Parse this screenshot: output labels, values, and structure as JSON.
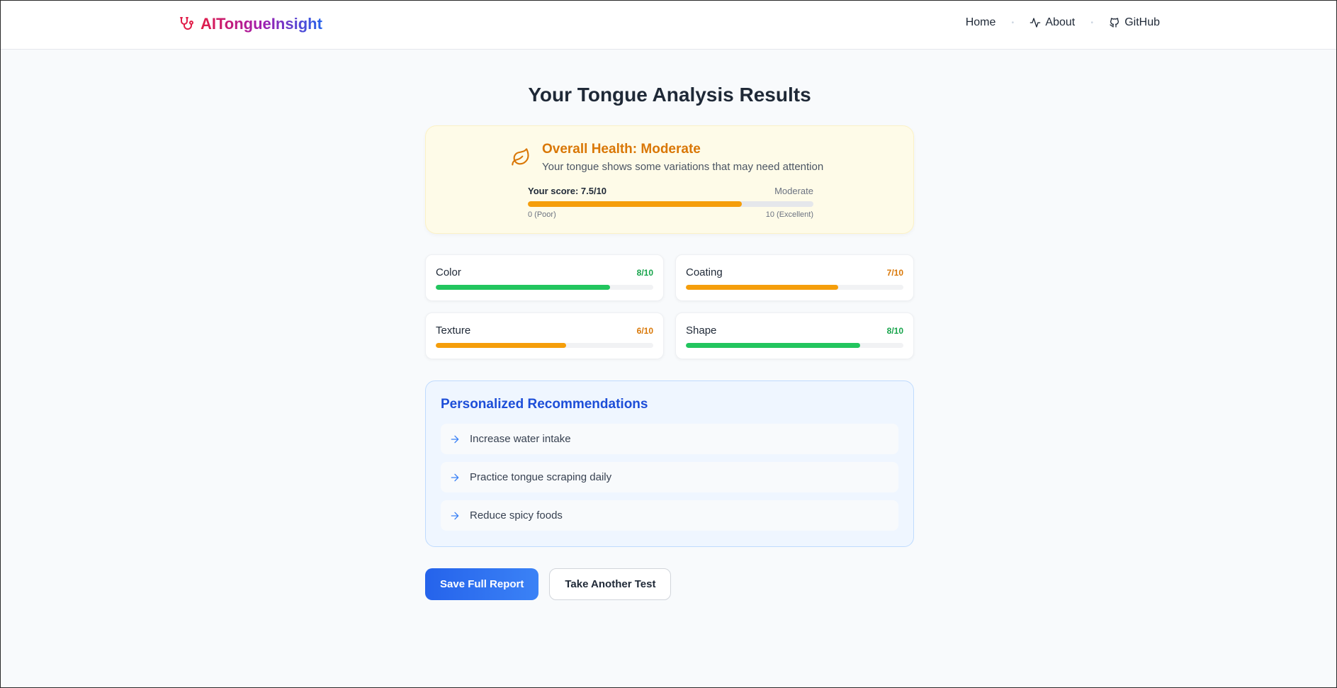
{
  "nav": {
    "brand": "AITongueInsight",
    "links": [
      {
        "label": "Home",
        "icon": "none"
      },
      {
        "label": "About",
        "icon": "activity-icon"
      },
      {
        "label": "GitHub",
        "icon": "github-icon"
      }
    ]
  },
  "page_title": "Your Tongue Analysis Results",
  "overall": {
    "title": "Overall Health: Moderate",
    "subtitle": "Your tongue shows some variations that may need attention",
    "score_label": "Your score: 7.5/10",
    "score_word": "Moderate",
    "score_value": 7.5,
    "score_max": 10,
    "min_label": "0 (Poor)",
    "max_label": "10 (Excellent)",
    "color": "#f59e0b"
  },
  "metrics": [
    {
      "name": "Color",
      "score_text": "8/10",
      "value": 8,
      "color": "#22c55e",
      "text_color": "#16a34a"
    },
    {
      "name": "Coating",
      "score_text": "7/10",
      "value": 7,
      "color": "#f59e0b",
      "text_color": "#d97706"
    },
    {
      "name": "Texture",
      "score_text": "6/10",
      "value": 6,
      "color": "#f59e0b",
      "text_color": "#d97706"
    },
    {
      "name": "Shape",
      "score_text": "8/10",
      "value": 8,
      "color": "#22c55e",
      "text_color": "#16a34a"
    }
  ],
  "recommendations": {
    "title": "Personalized Recommendations",
    "items": [
      "Increase water intake",
      "Practice tongue scraping daily",
      "Reduce spicy foods"
    ]
  },
  "actions": {
    "save_label": "Save Full Report",
    "retake_label": "Take Another Test"
  },
  "colors": {
    "accent": "#2563eb",
    "warning": "#f59e0b",
    "success": "#22c55e"
  }
}
